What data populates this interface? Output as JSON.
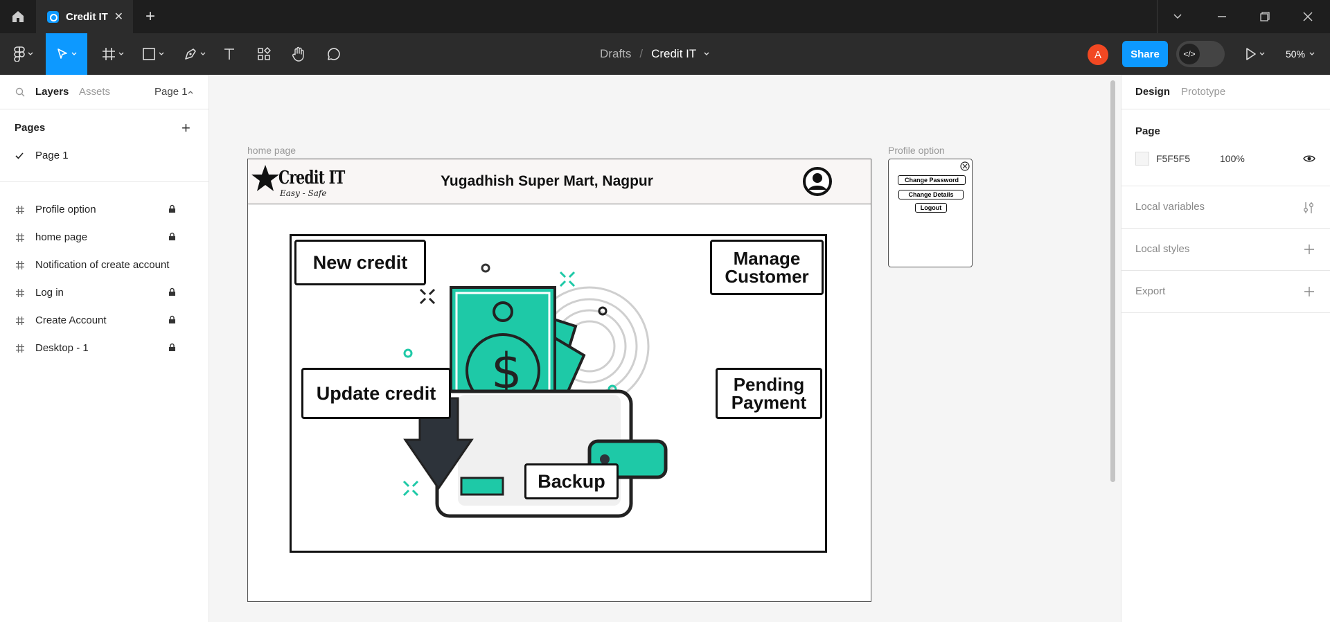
{
  "titlebar": {
    "tab_title": "Credit IT",
    "tab_close": "✕",
    "new_tab": "+"
  },
  "toolbar": {
    "breadcrumb_parent": "Drafts",
    "breadcrumb_separator": "/",
    "file_name": "Credit IT",
    "avatar_initial": "A",
    "share_label": "Share",
    "dev_mode_symbol": "</>",
    "zoom": "50%"
  },
  "left_panel": {
    "tabs": {
      "layers": "Layers",
      "assets": "Assets",
      "page": "Page 1"
    },
    "pages_heading": "Pages",
    "add_symbol": "+",
    "current_page": "Page 1",
    "layers": [
      {
        "label": "Profile option",
        "locked": true
      },
      {
        "label": "home page",
        "locked": true
      },
      {
        "label": "Notification of create account",
        "locked": false
      },
      {
        "label": "Log in",
        "locked": true
      },
      {
        "label": "Create Account",
        "locked": true
      },
      {
        "label": "Desktop - 1",
        "locked": true
      }
    ]
  },
  "canvas": {
    "home_frame_label": "home page",
    "profile_frame_label": "Profile option",
    "home": {
      "logo_text": "Credit IT",
      "logo_tagline": "Easy - Safe",
      "store_name": "Yugadhish Super Mart, Nagpur",
      "tiles": {
        "new_credit": "New credit",
        "manage_line1": "Manage",
        "manage_line2": "Customer",
        "update_credit": "Update credit",
        "pending_line1": "Pending",
        "pending_line2": "Payment",
        "backup": "Backup"
      }
    },
    "profile": {
      "change_password": "Change Password",
      "change_details": "Change Details",
      "logout": "Logout"
    }
  },
  "right_panel": {
    "tabs": {
      "design": "Design",
      "prototype": "Prototype"
    },
    "page_heading": "Page",
    "bg_hex": "F5F5F5",
    "bg_opacity": "100%",
    "local_variables": "Local variables",
    "local_styles": "Local styles",
    "export": "Export"
  },
  "colors": {
    "accent": "#0d99ff",
    "avatar": "#f24822",
    "teal": "#1ec9a7",
    "dark": "#1e1e1e"
  }
}
